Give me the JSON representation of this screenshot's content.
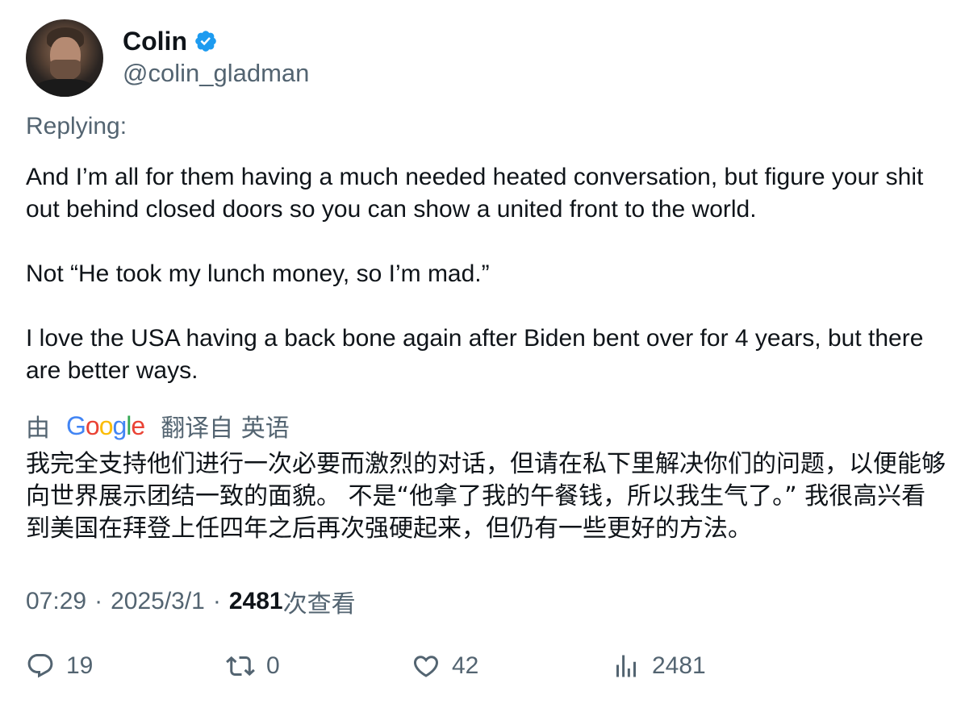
{
  "author": {
    "display_name": "Colin",
    "handle": "@colin_gladman",
    "verified_icon": "verified-badge-icon",
    "accent_color": "#1d9bf0"
  },
  "replying_label": "Replying:",
  "tweet": {
    "paragraphs": [
      "And I’m all for them having a much needed heated conversation, but figure your shit out behind closed doors so you can show a united front to the world.",
      "Not “He took my lunch money, so I’m mad.”",
      "I love the USA having a back bone again after Biden bent over for 4 years, but there are better ways."
    ]
  },
  "translation": {
    "prefix": "由",
    "google_letters": [
      "G",
      "o",
      "o",
      "g",
      "l",
      "e"
    ],
    "google_colors": [
      "#4285f4",
      "#ea4335",
      "#fbbc05",
      "#4285f4",
      "#34a853",
      "#ea4335"
    ],
    "suffix": "翻译自 英语",
    "text": "我完全支持他们进行一次必要而激烈的对话，但请在私下里解决你们的问题，以便能够向世界展示团结一致的面貌。 不是“他拿了我的午餐钱，所以我生气了。” 我很高兴看到美国在拜登上任四年之后再次强硬起来，但仍有一些更好的方法。"
  },
  "meta": {
    "time": "07:29",
    "separator": "·",
    "date": "2025/3/1",
    "views_count": "2481",
    "views_label": "次查看"
  },
  "actions": {
    "replies": "19",
    "retweets": "0",
    "likes": "42",
    "views": "2481"
  }
}
